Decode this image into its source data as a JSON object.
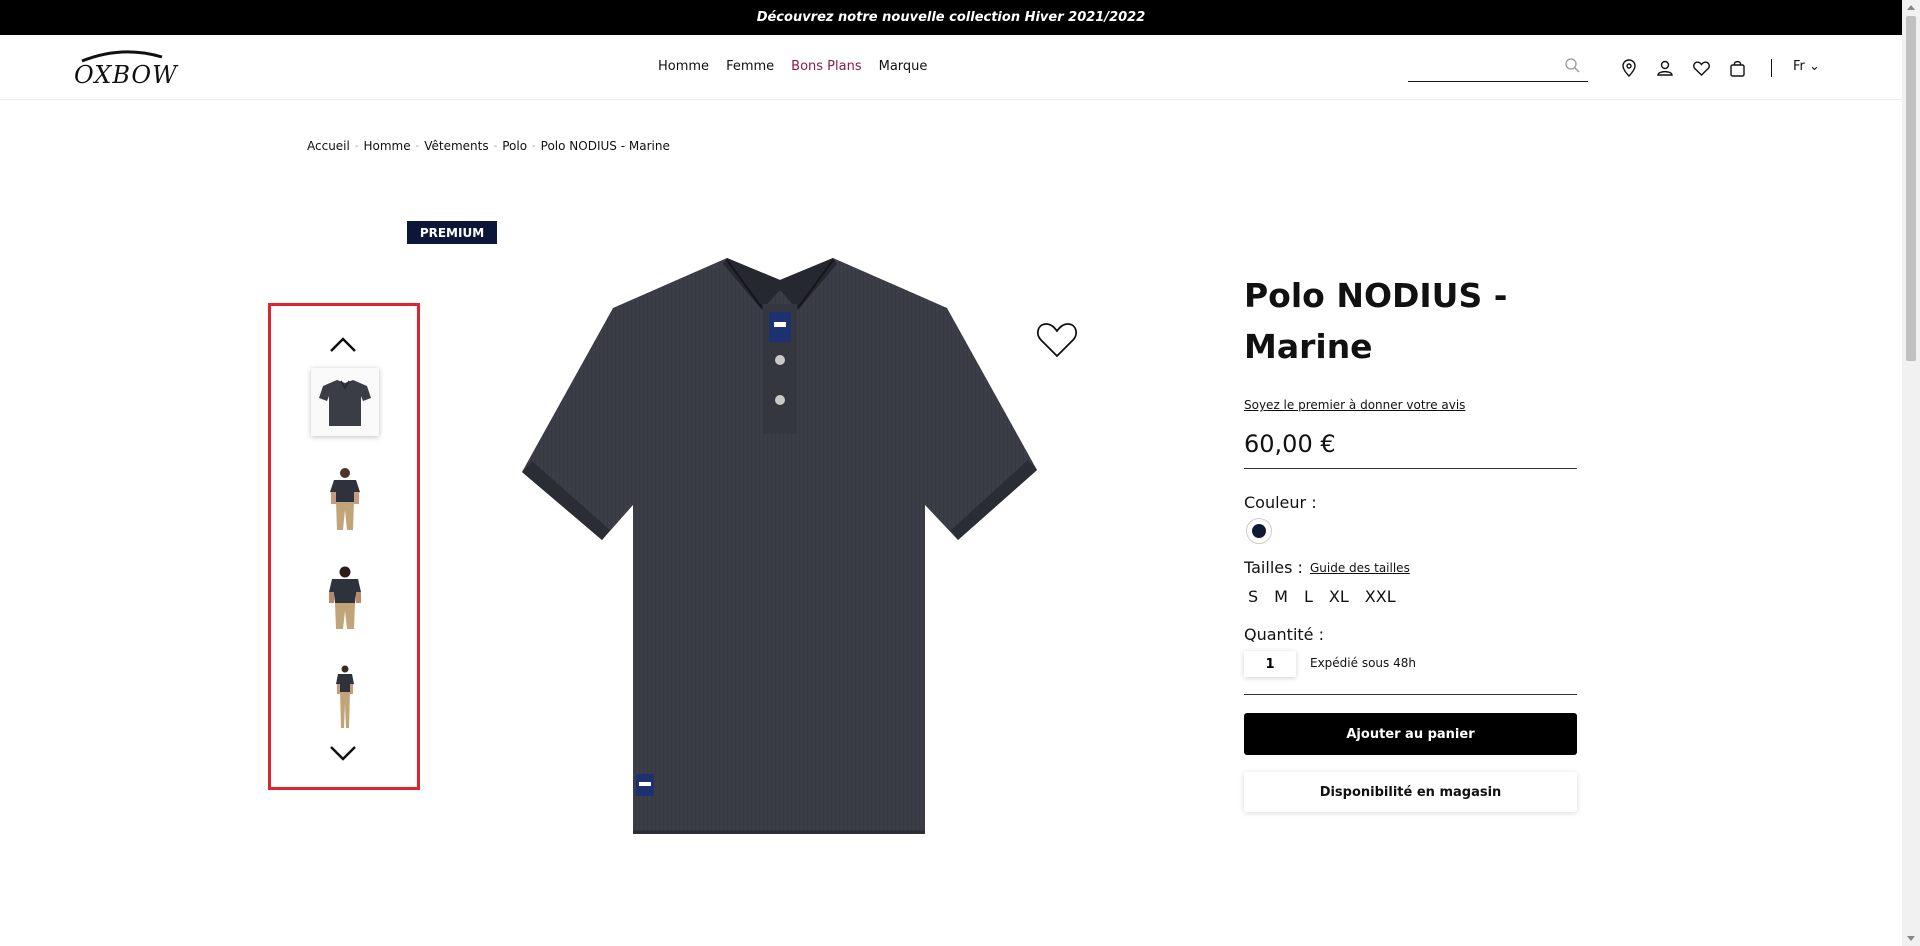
{
  "announcement": "Découvrez notre nouvelle collection Hiver 2021/2022",
  "header": {
    "logo_text": "OXBOW",
    "nav": [
      "Homme",
      "Femme",
      "Bons Plans",
      "Marque"
    ],
    "search_placeholder": "",
    "icons": [
      "search-icon",
      "location-pin-icon",
      "user-icon",
      "heart-icon",
      "shopping-bag-icon"
    ],
    "language": "Fr ⌄"
  },
  "breadcrumb": [
    "Accueil",
    "Homme",
    "Vêtements",
    "Polo",
    "Polo NODIUS - Marine"
  ],
  "breadcrumb_separator": "-",
  "badge": "PREMIUM",
  "gallery": {
    "thumbnails": [
      "polo-flat",
      "model-front",
      "model-back",
      "model-full"
    ],
    "active_index": 0
  },
  "product": {
    "title": "Polo NODIUS - Marine",
    "review_link": "Soyez le premier à donner votre avis",
    "price": "60,00 €",
    "color_label": "Couleur :",
    "color_swatch": "#111a33",
    "sizes_label": "Tailles :",
    "size_guide": "Guide des tailles",
    "sizes": [
      "S",
      "M",
      "L",
      "XL",
      "XXL"
    ],
    "quantity_label": "Quantité :",
    "quantity": "1",
    "shipping": "Expédié sous 48h",
    "add_to_cart": "Ajouter au panier",
    "store_availability": "Disponibilité en magasin"
  },
  "colors": {
    "topbar": "#000000",
    "promo_nav": "#8b1b4a",
    "badge": "#0b1639",
    "highlight_border": "#e0242f"
  }
}
